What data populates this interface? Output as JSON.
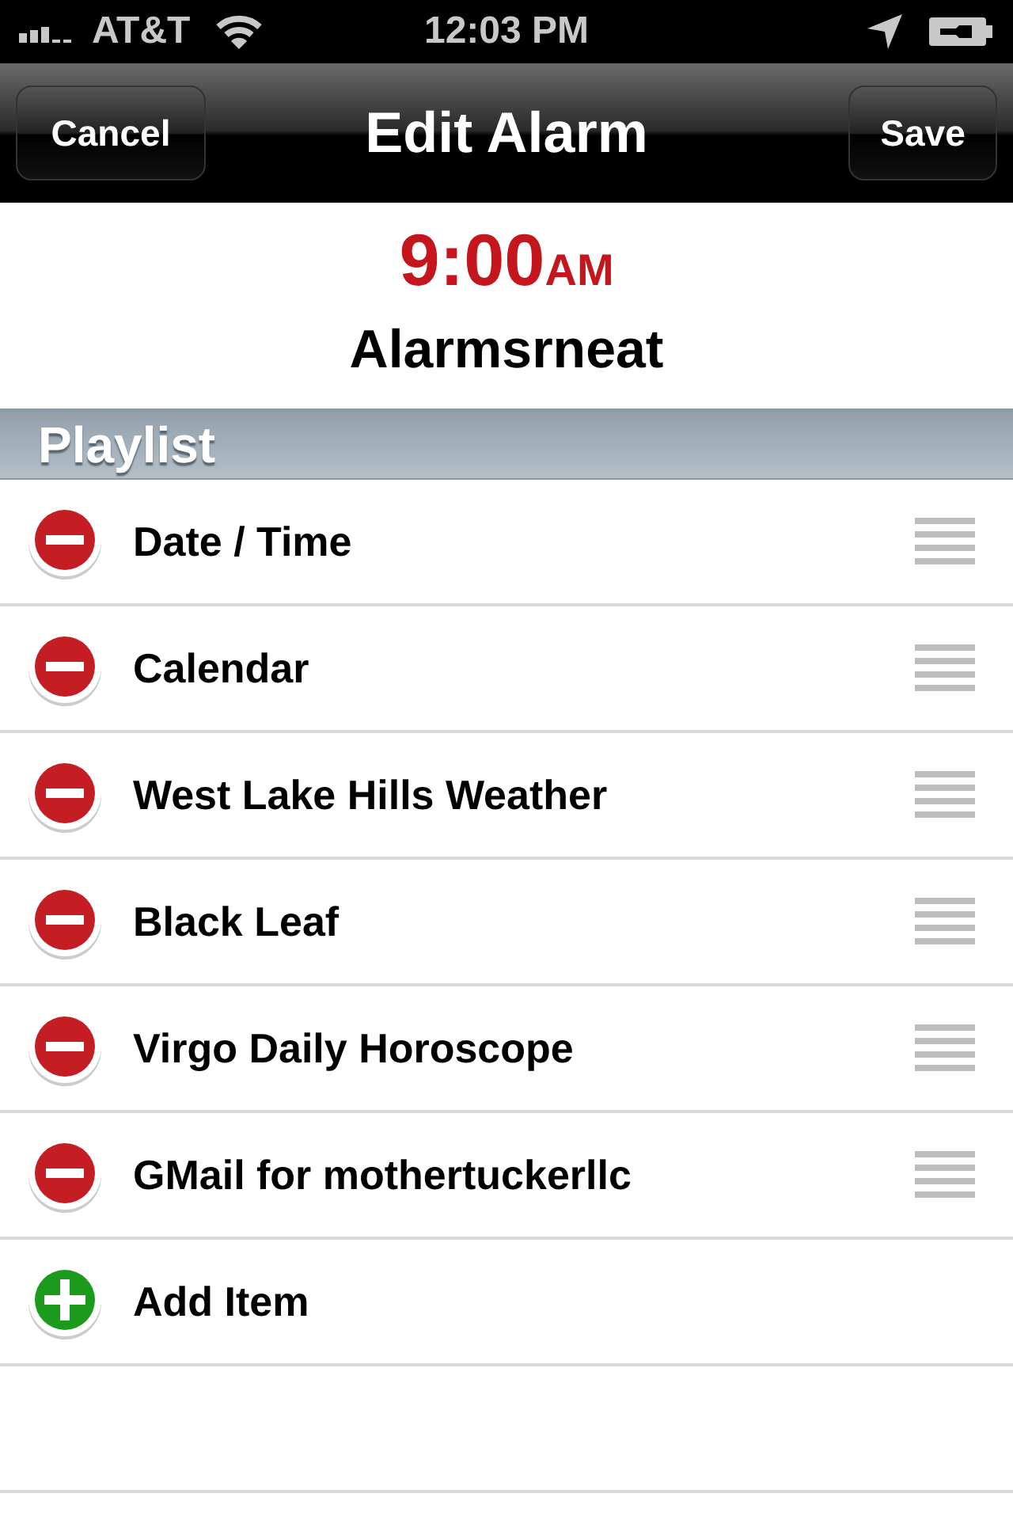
{
  "status_bar": {
    "carrier": "AT&T",
    "time": "12:03 PM"
  },
  "nav_bar": {
    "title": "Edit Alarm",
    "left_button": "Cancel",
    "right_button": "Save"
  },
  "alarm": {
    "time": "9:00",
    "period": "AM",
    "name": "Alarmsrneat"
  },
  "section": {
    "title": "Playlist"
  },
  "rows": [
    {
      "kind": "delete",
      "label": "Date / Time"
    },
    {
      "kind": "delete",
      "label": "Calendar"
    },
    {
      "kind": "delete",
      "label": "West Lake Hills Weather"
    },
    {
      "kind": "delete",
      "label": "Black Leaf"
    },
    {
      "kind": "delete",
      "label": "Virgo Daily Horoscope"
    },
    {
      "kind": "delete",
      "label": "GMail for mothertuckerllc"
    },
    {
      "kind": "add",
      "label": "Add Item"
    }
  ]
}
